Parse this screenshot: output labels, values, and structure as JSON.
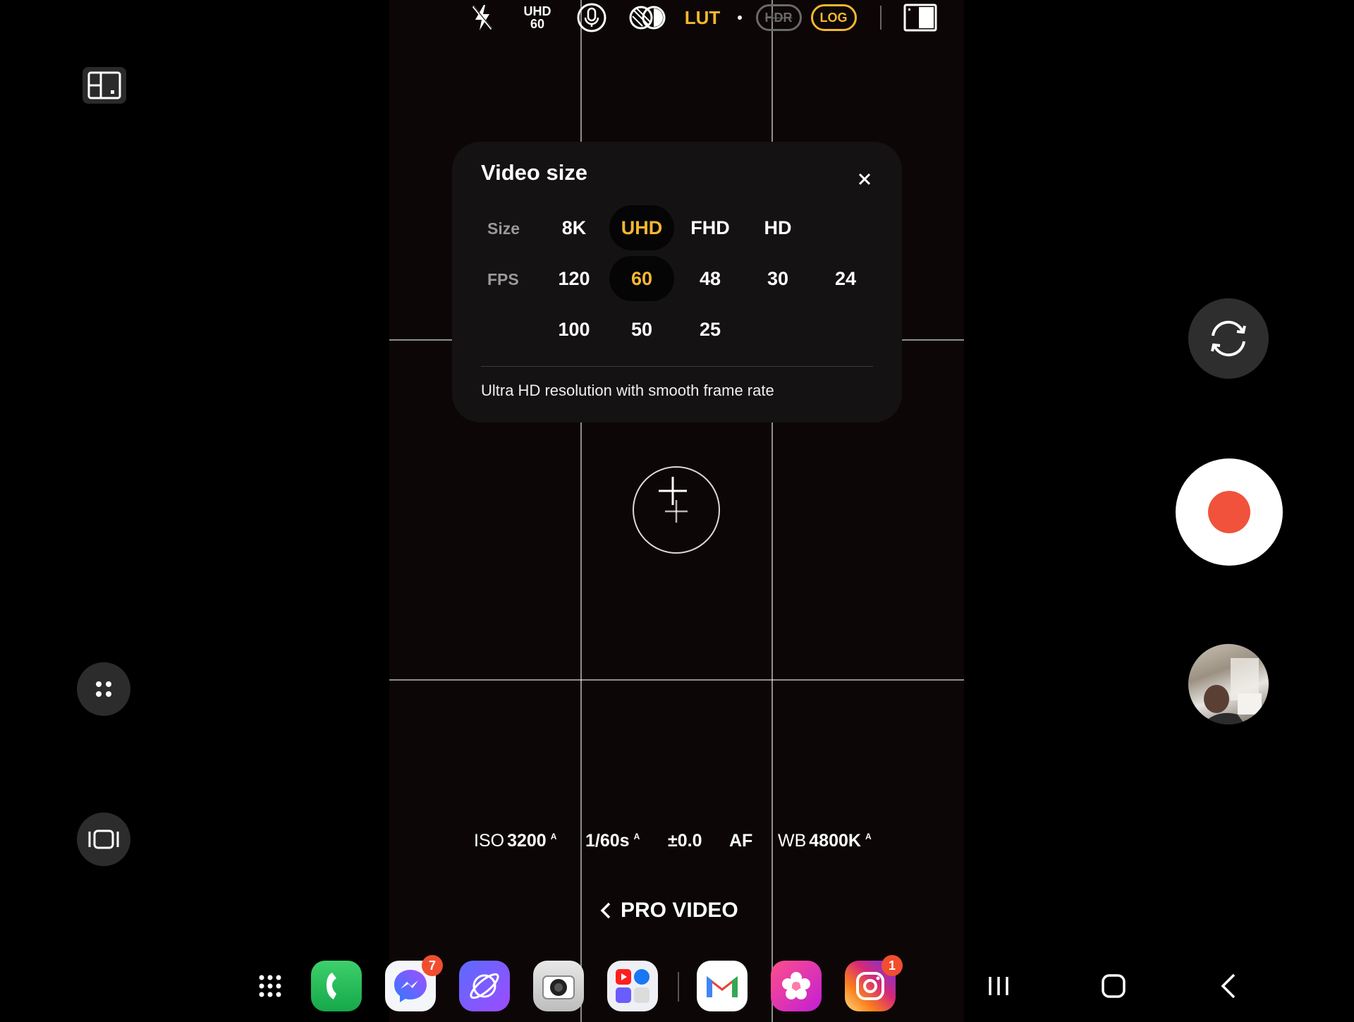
{
  "top_toolbar": {
    "flash_icon": "flash-off-icon",
    "video_size_badge": {
      "size": "UHD",
      "fps": "60"
    },
    "mic_icon": "microphone-icon",
    "filter_icon": "filter-icon",
    "lut_label": "LUT",
    "hdr_label": "HDR",
    "log_label": "LOG",
    "aspect_icon": "aspect-ratio-icon"
  },
  "video_size_popup": {
    "title": "Video size",
    "size_row_label": "Size",
    "size_options": [
      "8K",
      "UHD",
      "FHD",
      "HD"
    ],
    "selected_size": "UHD",
    "fps_row_label": "FPS",
    "fps_options_row1": [
      "120",
      "60",
      "48",
      "30",
      "24"
    ],
    "fps_options_row2": [
      "100",
      "50",
      "25"
    ],
    "selected_fps": "60",
    "description": "Ultra HD resolution with smooth frame rate"
  },
  "pro_controls": {
    "iso": {
      "key": "ISO",
      "value": "3200",
      "auto": "A"
    },
    "shutter": {
      "value": "1/60s",
      "auto": "A"
    },
    "ev": {
      "value": "±0.0"
    },
    "focus": {
      "value": "AF"
    },
    "wb": {
      "key": "WB",
      "value": "4800K",
      "auto": "A"
    }
  },
  "mode": {
    "label": "PRO VIDEO"
  },
  "taskbar": {
    "badges": {
      "messenger": "7",
      "instagram": "1"
    }
  },
  "colors": {
    "accent": "#f4b730",
    "record": "#f1523c",
    "panel": "#141212"
  }
}
